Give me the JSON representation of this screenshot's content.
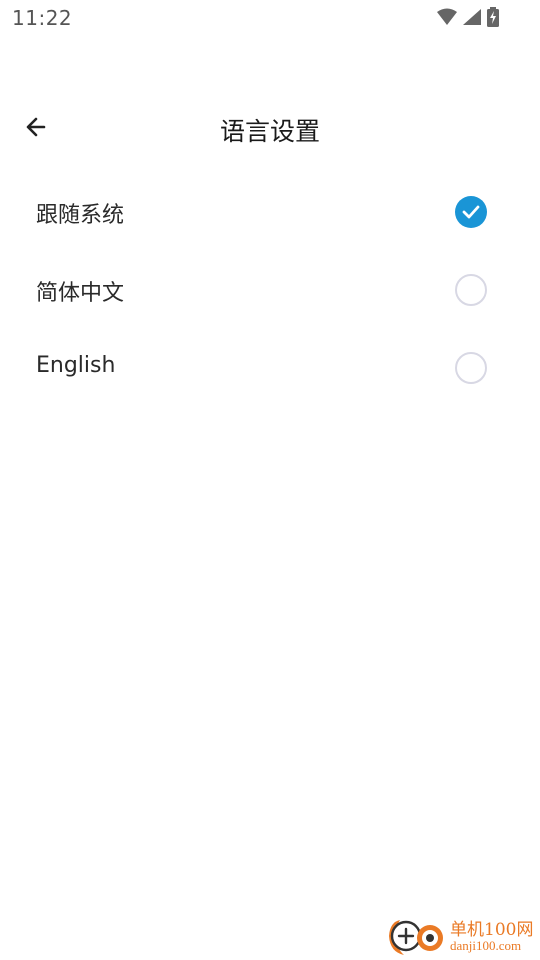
{
  "status_bar": {
    "time": "11:22",
    "icons": [
      "wifi-icon",
      "cell-signal-icon",
      "battery-charging-icon"
    ]
  },
  "header": {
    "back_icon": "arrow-left-icon",
    "title": "语言设置"
  },
  "options": [
    {
      "label": "跟随系统",
      "selected": true
    },
    {
      "label": "简体中文",
      "selected": false
    },
    {
      "label": "English",
      "selected": false
    }
  ],
  "colors": {
    "accent": "#1a95d6",
    "radio_border": "#d8d8e4",
    "watermark": "#ea7a25"
  },
  "watermark": {
    "name": "单机100网",
    "url": "danji100.com"
  }
}
